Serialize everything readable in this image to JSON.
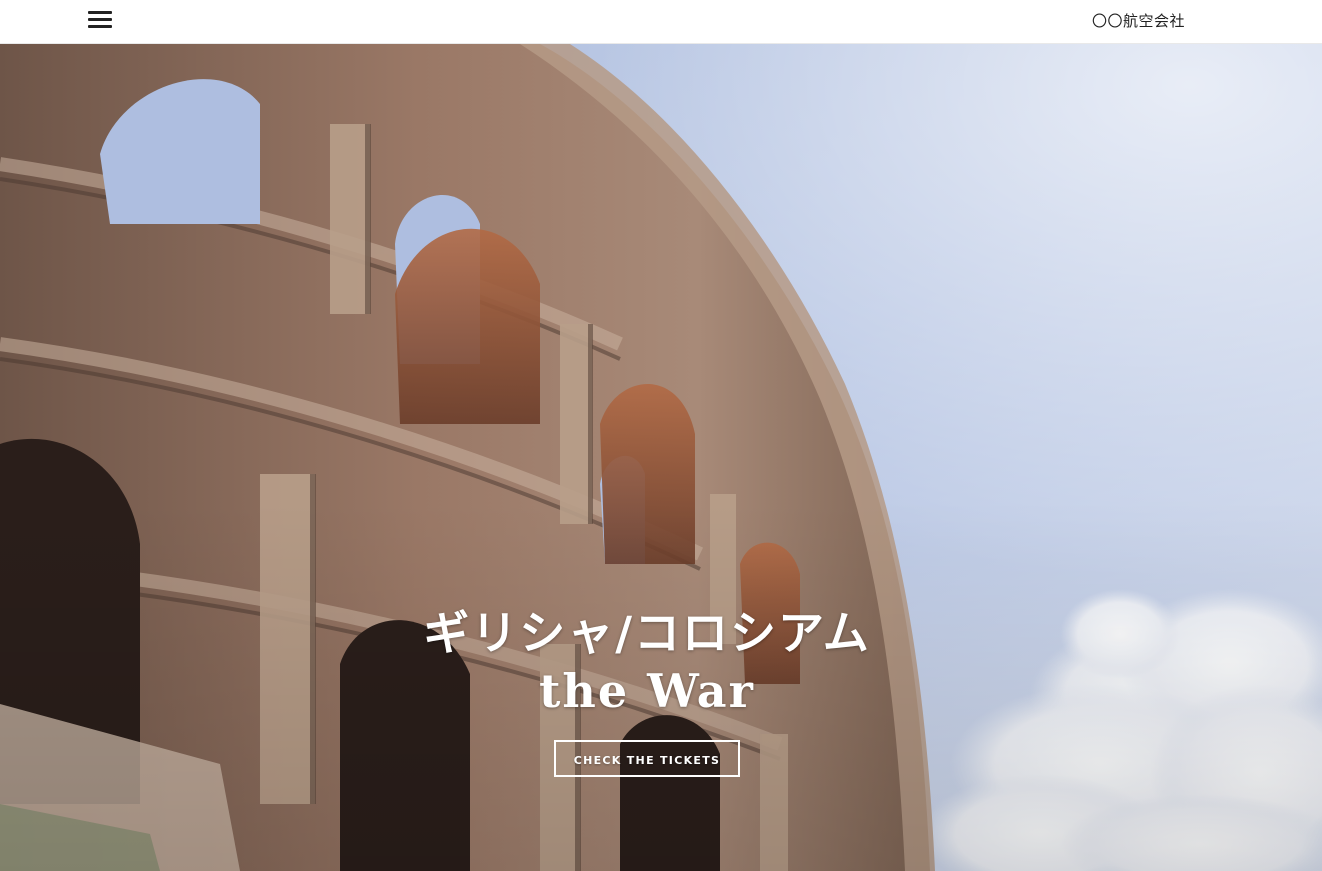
{
  "header": {
    "brand": "〇〇航空会社",
    "menu_icon": "hamburger-menu-icon"
  },
  "hero": {
    "title_line1": "ギリシャ/コロシアム",
    "title_line2": "the War",
    "cta_label": "CHECK THE TICKETS",
    "image": "colosseum-photo"
  },
  "colors": {
    "header_bg": "#ffffff",
    "text_dark": "#222222",
    "hero_text": "#ffffff",
    "sky": "#b8c6e2",
    "stone": "#8a6a5a"
  }
}
